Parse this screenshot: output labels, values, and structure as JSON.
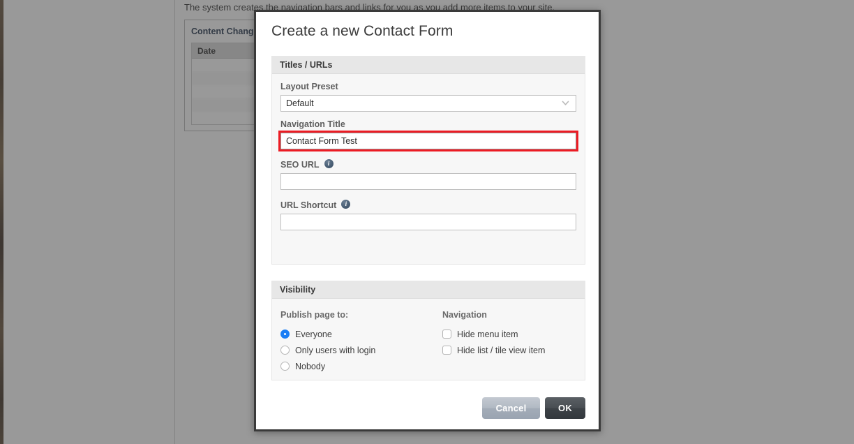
{
  "background": {
    "intro_text": "The system creates the navigation bars and links for you as you add more items to your site.",
    "panel_title": "Content Changes",
    "table": {
      "header": "Date",
      "rows": [
        "",
        "",
        "",
        "",
        ""
      ]
    },
    "resize_glyph": "◢"
  },
  "modal": {
    "title": "Create a new Contact Form",
    "sections": {
      "titles_urls": {
        "heading": "Titles / URLs",
        "fields": {
          "layout_preset": {
            "label": "Layout Preset",
            "value": "Default",
            "options": [
              "Default"
            ],
            "chevron": "chevron-down-icon"
          },
          "navigation_title": {
            "label": "Navigation Title",
            "value": "Contact Form Test",
            "placeholder": "",
            "highlighted": true
          },
          "seo_url": {
            "label": "SEO URL",
            "value": "",
            "placeholder": "",
            "info": "info-icon"
          },
          "url_shortcut": {
            "label": "URL Shortcut",
            "value": "",
            "placeholder": "",
            "info": "info-icon"
          }
        }
      },
      "visibility": {
        "heading": "Visibility",
        "publish": {
          "label": "Publish page to:",
          "options": [
            {
              "label": "Everyone",
              "checked": true
            },
            {
              "label": "Only users with login",
              "checked": false
            },
            {
              "label": "Nobody",
              "checked": false
            }
          ]
        },
        "navigation": {
          "label": "Navigation",
          "options": [
            {
              "label": "Hide menu item",
              "checked": false
            },
            {
              "label": "Hide list / tile view item",
              "checked": false
            }
          ]
        }
      }
    },
    "footer": {
      "cancel_label": "Cancel",
      "ok_label": "OK"
    }
  },
  "colors": {
    "accent_blue": "#1a7ef5",
    "highlight_red": "#ec1c24",
    "panel_header": "#e7e7e7",
    "panel_body": "#f7f7f7",
    "ok_button": "#3d4247",
    "cancel_button": "#a3acb8",
    "modal_border": "#3a3a3a",
    "info_icon": "#4a5f75"
  }
}
